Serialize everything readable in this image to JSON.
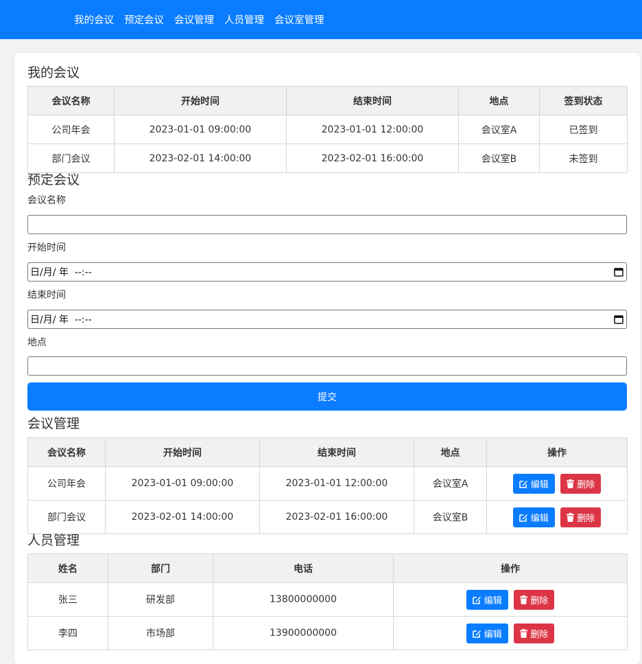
{
  "nav": {
    "items": [
      "我的会议",
      "预定会议",
      "会议管理",
      "人员管理",
      "会议室管理"
    ]
  },
  "my_meetings": {
    "title": "我的会议",
    "headers": [
      "会议名称",
      "开始时间",
      "结束时间",
      "地点",
      "签到状态"
    ],
    "rows": [
      [
        "公司年会",
        "2023-01-01 09:00:00",
        "2023-01-01 12:00:00",
        "会议室A",
        "已签到"
      ],
      [
        "部门会议",
        "2023-02-01 14:00:00",
        "2023-02-01 16:00:00",
        "会议室B",
        "未签到"
      ]
    ]
  },
  "booking": {
    "title": "预定会议",
    "name_label": "会议名称",
    "start_label": "开始时间",
    "start_value": "日/月/ 年  --:--",
    "end_label": "结束时间",
    "end_value": "日/月/ 年  --:--",
    "location_label": "地点",
    "submit_label": "提交"
  },
  "meeting_mgmt": {
    "title": "会议管理",
    "headers": [
      "会议名称",
      "开始时间",
      "结束时间",
      "地点",
      "操作"
    ],
    "rows": [
      [
        "公司年会",
        "2023-01-01 09:00:00",
        "2023-01-01 12:00:00",
        "会议室A"
      ],
      [
        "部门会议",
        "2023-02-01 14:00:00",
        "2023-02-01 16:00:00",
        "会议室B"
      ]
    ],
    "edit_label": "编辑",
    "delete_label": "删除"
  },
  "people_mgmt": {
    "title": "人员管理",
    "headers": [
      "姓名",
      "部门",
      "电话",
      "操作"
    ],
    "rows": [
      [
        "张三",
        "研发部",
        "13800000000"
      ],
      [
        "李四",
        "市场部",
        "13900000000"
      ]
    ],
    "edit_label": "编辑",
    "delete_label": "删除"
  },
  "colors": {
    "primary": "#0a7cff",
    "danger": "#dc3545",
    "header_bg": "#f1f1f1"
  },
  "icons": {
    "edit": "edit-icon",
    "delete": "trash-icon",
    "calendar": "calendar-icon"
  }
}
